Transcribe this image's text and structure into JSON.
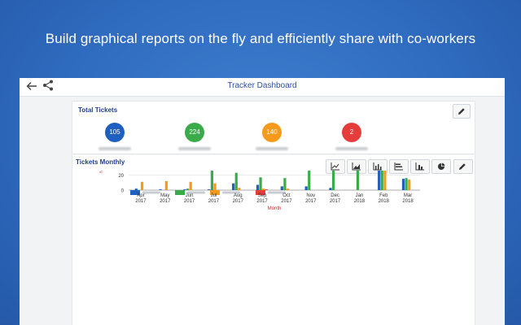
{
  "promo": {
    "headline": "Build graphical reports on the fly and efficiently share with co-workers"
  },
  "app": {
    "title": "Tracker Dashboard",
    "back_icon": "arrow-left-icon",
    "share_icon": "share-icon"
  },
  "total_tickets": {
    "title": "Total Tickets",
    "stats": [
      {
        "value": "105",
        "color": "#1f5fbf"
      },
      {
        "value": "224",
        "color": "#3aab49"
      },
      {
        "value": "140",
        "color": "#f59a1b"
      },
      {
        "value": "2",
        "color": "#e73c3c"
      }
    ]
  },
  "tickets_monthly": {
    "title": "Tickets Monthly",
    "toolbar_icons": [
      "line-chart-icon",
      "area-chart-icon",
      "bar-chart-icon",
      "horizontal-bar-icon",
      "stacked-bar-icon",
      "pie-chart-icon",
      "pencil-icon"
    ]
  },
  "chart_data": {
    "type": "bar",
    "xlabel": "Month",
    "ylabel": "No of Tickets",
    "ylim": [
      0,
      80
    ],
    "yticks": [
      0,
      20,
      40,
      60,
      80
    ],
    "grid": true,
    "legend_position": "top-left",
    "categories": [
      [
        "Apr",
        "2017"
      ],
      [
        "May",
        "2017"
      ],
      [
        "Jun",
        "2017"
      ],
      [
        "Jul",
        "2017"
      ],
      [
        "Aug",
        "2017"
      ],
      [
        "Sep",
        "2017"
      ],
      [
        "Oct",
        "2017"
      ],
      [
        "Nov",
        "2017"
      ],
      [
        "Dec",
        "2017"
      ],
      [
        "Jan",
        "2018"
      ],
      [
        "Feb",
        "2018"
      ],
      [
        "Mar",
        "2018"
      ]
    ],
    "series": [
      {
        "color": "#1f5fbf",
        "values": [
          2,
          1,
          1,
          1,
          9,
          7,
          5,
          5,
          3,
          0,
          44,
          15
        ]
      },
      {
        "color": "#3aab49",
        "values": [
          0,
          0,
          2,
          35,
          23,
          17,
          16,
          28,
          26,
          29,
          28,
          16
        ]
      },
      {
        "color": "#f59a1b",
        "values": [
          11,
          12,
          11,
          9,
          3,
          2,
          2,
          0,
          0,
          0,
          62,
          14
        ]
      },
      {
        "color": "#e73c3c",
        "values": [
          0,
          0,
          0,
          0,
          0,
          1,
          0,
          0,
          0,
          0,
          0,
          0
        ]
      }
    ]
  }
}
